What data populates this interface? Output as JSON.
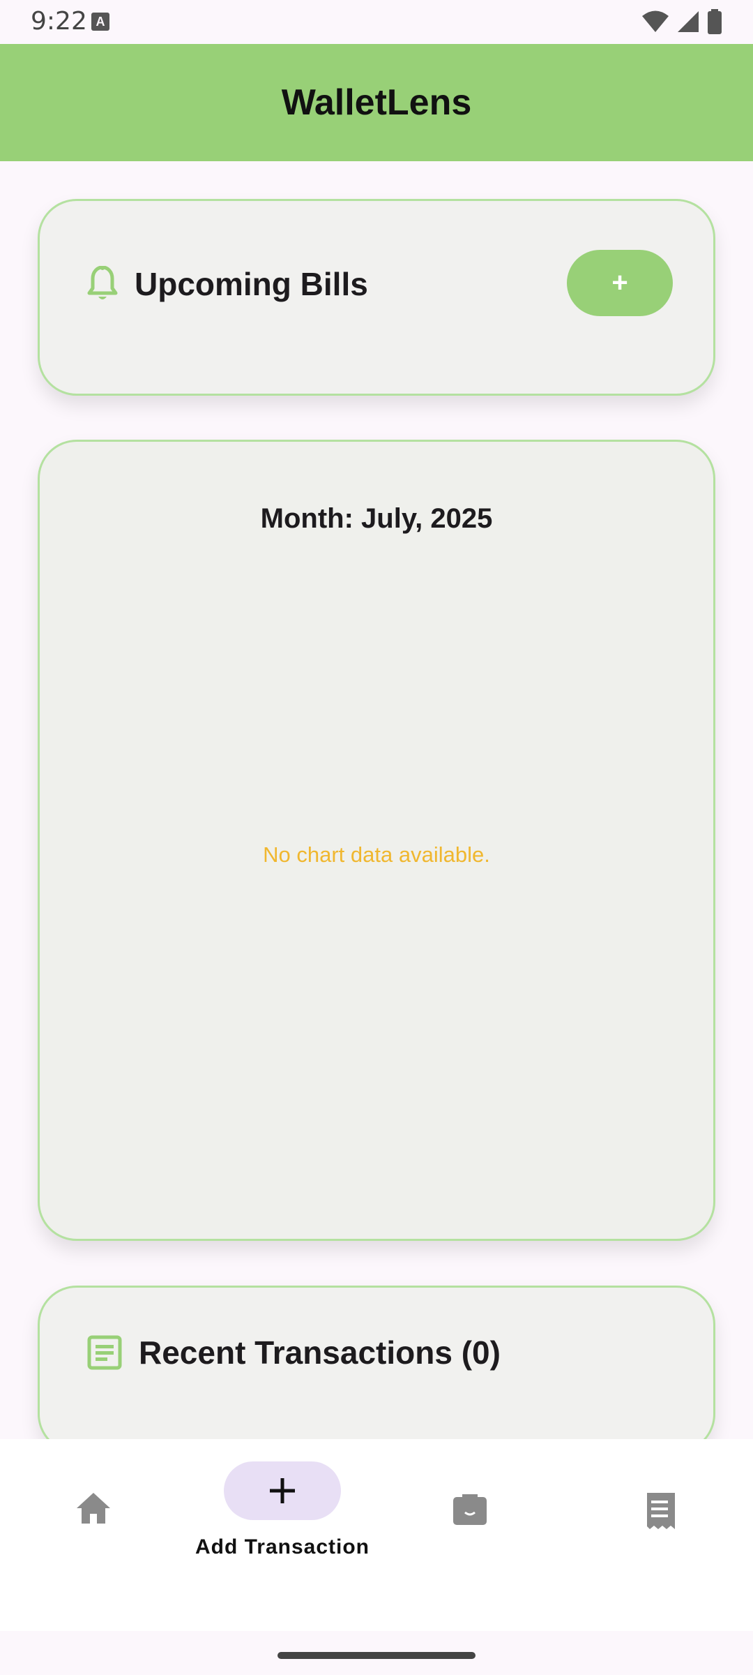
{
  "status_bar": {
    "time": "9:22",
    "notification_icon": "A",
    "icons": [
      "wifi-icon",
      "signal-icon",
      "battery-icon"
    ]
  },
  "app_bar": {
    "title": "WalletLens",
    "background_color": "#98d077"
  },
  "upcoming_bills": {
    "icon": "bell-icon",
    "title": "Upcoming Bills",
    "add_label": "+"
  },
  "chart_card": {
    "month_label": "Month: July, 2025",
    "empty_message": "No chart data available.",
    "empty_message_color": "#f0b72f"
  },
  "recent_transactions": {
    "icon": "document-list-icon",
    "title": "Recent Transactions (0)"
  },
  "bottom_nav": {
    "items": [
      {
        "icon": "home-icon",
        "label": ""
      },
      {
        "icon": "plus-icon",
        "label": "Add Transaction",
        "selected": true
      },
      {
        "icon": "wallet-icon",
        "label": ""
      },
      {
        "icon": "receipt-icon",
        "label": ""
      }
    ],
    "selected_pill_color": "#e8dff5"
  },
  "colors": {
    "accent_green": "#98d077",
    "card_border": "#b4e1a0",
    "card_background": "#f1f1ef",
    "page_background": "#fcf7fc"
  }
}
